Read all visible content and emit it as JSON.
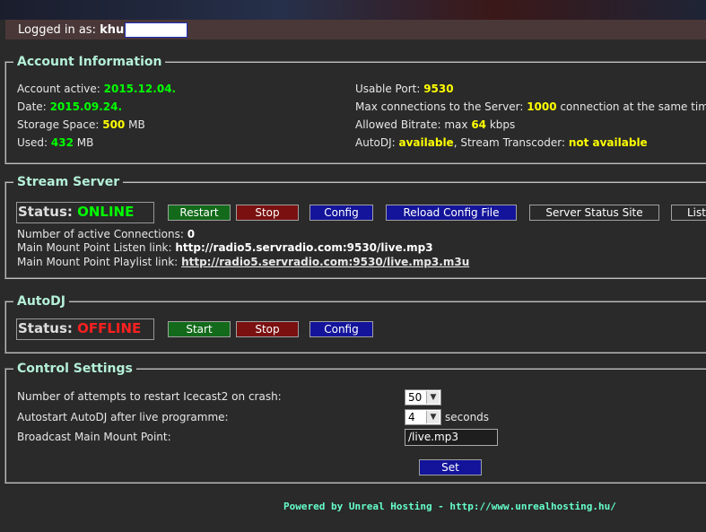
{
  "login": {
    "label": "Logged in as:",
    "username": "khu"
  },
  "account": {
    "legend": "Account Information",
    "active_label": "Account active:",
    "active_value": "2015.12.04.",
    "date_label": "Date:",
    "date_value": "2015.09.24.",
    "storage_label": "Storage Space:",
    "storage_value": "500",
    "storage_unit": "MB",
    "used_label": "Used:",
    "used_value": "432",
    "used_unit": "MB",
    "port_label": "Usable Port:",
    "port_value": "9530",
    "maxconn_label": "Max connections to the Server:",
    "maxconn_value": "1000",
    "maxconn_suffix": "connection at the same time",
    "bitrate_label": "Allowed Bitrate: max",
    "bitrate_value": "64",
    "bitrate_unit": "kbps",
    "autodj_label": "AutoDJ:",
    "autodj_value": "available",
    "transcoder_label": ", Stream Transcoder:",
    "transcoder_value": "not available"
  },
  "stream": {
    "legend": "Stream Server",
    "status_label": "Status:",
    "status_value": "ONLINE",
    "buttons": {
      "restart": "Restart",
      "stop": "Stop",
      "config": "Config",
      "reload": "Reload Config File",
      "status_site": "Server Status Site",
      "listen": "Listen"
    },
    "connections_label": "Number of active Connections:",
    "connections_value": "0",
    "listen_label": "Main Mount Point Listen link:",
    "listen_value": "http://radio5.servradio.com:9530/live.mp3",
    "playlist_label": "Main Mount Point Playlist link:",
    "playlist_value": "http://radio5.servradio.com:9530/live.mp3.m3u"
  },
  "autodj": {
    "legend": "AutoDJ",
    "status_label": "Status:",
    "status_value": "OFFLINE",
    "buttons": {
      "start": "Start",
      "stop": "Stop",
      "config": "Config"
    }
  },
  "control": {
    "legend": "Control Settings",
    "restart_label": "Number of attempts to restart Icecast2 on crash:",
    "restart_value": "50",
    "autostart_label": "Autostart AutoDJ after live programme:",
    "autostart_value": "4",
    "autostart_unit": "seconds",
    "broadcast_label": "Broadcast Main Mount Point:",
    "broadcast_value": "/live.mp3",
    "set_button": "Set"
  },
  "footer": "Powered by Unreal Hosting - http://www.unrealhosting.hu/"
}
